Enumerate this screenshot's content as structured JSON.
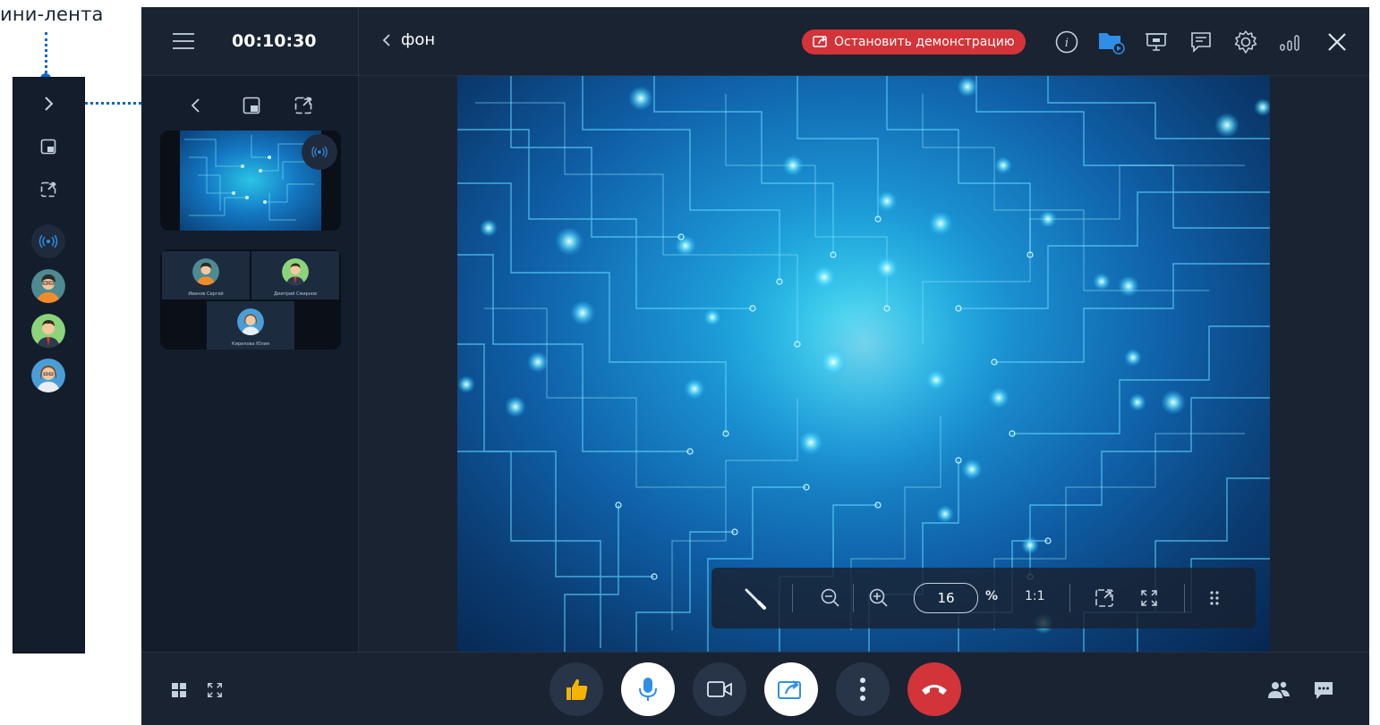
{
  "annotation": {
    "label": "ини-лента"
  },
  "call": {
    "timer": "00:10:30",
    "demo_title": "фон",
    "stop_demo_label": "Остановить демонстрацию"
  },
  "top_icons": [
    "info-icon",
    "folder-share-icon",
    "presentation-board-icon",
    "chat-board-icon",
    "gear-icon",
    "signal-icon",
    "close-icon"
  ],
  "participants": [
    {
      "name": "Иванов Сергей"
    },
    {
      "name": "Дмитрий Смирнов"
    },
    {
      "name": "Кирилова Юлия"
    }
  ],
  "toolbar": {
    "zoom_value": "16",
    "zoom_unit": "%",
    "actual_size_label": "1:1"
  },
  "colors": {
    "background": "#1a2332",
    "panel": "#141d2b",
    "danger": "#d3343a",
    "accent": "#2f8fe6",
    "annotation": "#0f67c8",
    "like_button": "#f5b400"
  }
}
